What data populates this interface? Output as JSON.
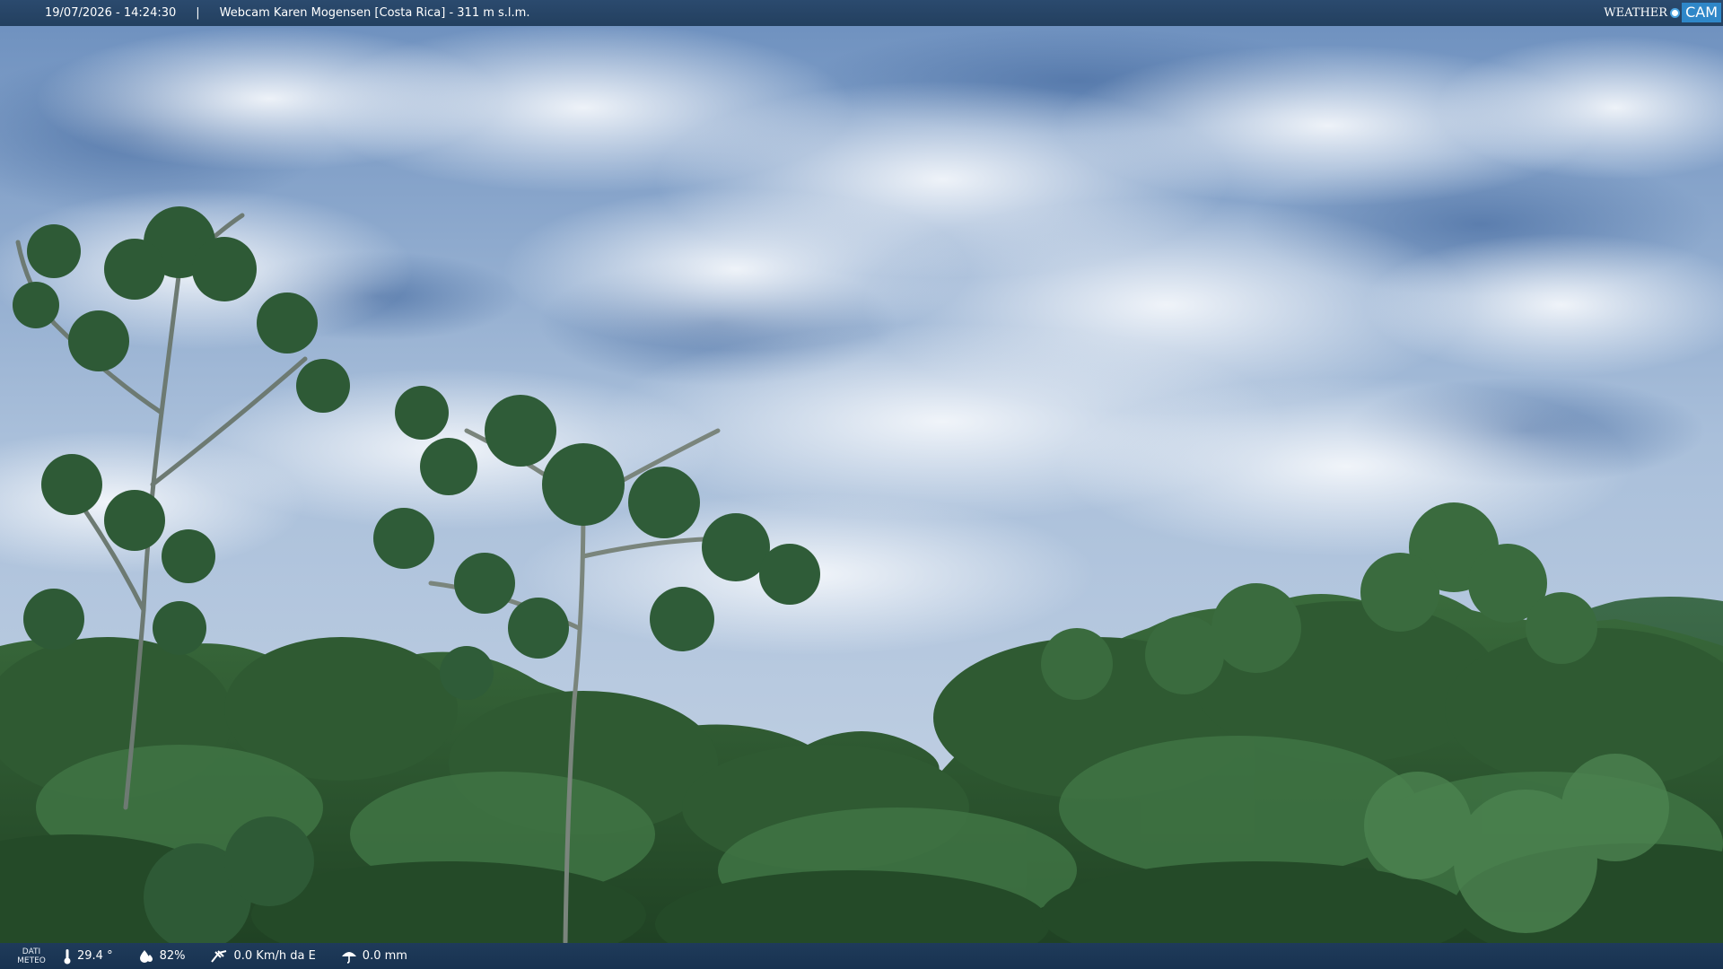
{
  "header": {
    "datetime": "19/07/2026 - 14:24:30",
    "separator": "|",
    "title": "Webcam Karen Mogensen [Costa Rica]  - 311 m s.l.m."
  },
  "logo": {
    "weather": "WEATHER",
    "cam": "CAM"
  },
  "meteo": {
    "tag_line1": "DATI",
    "tag_line2": "METEO",
    "temperature": "29.4 °",
    "humidity": "82%",
    "wind": "0.0 Km/h da E",
    "rain": "0.0 mm"
  },
  "colors": {
    "bar": "#23405f",
    "logo_accent": "#2f87c8"
  }
}
